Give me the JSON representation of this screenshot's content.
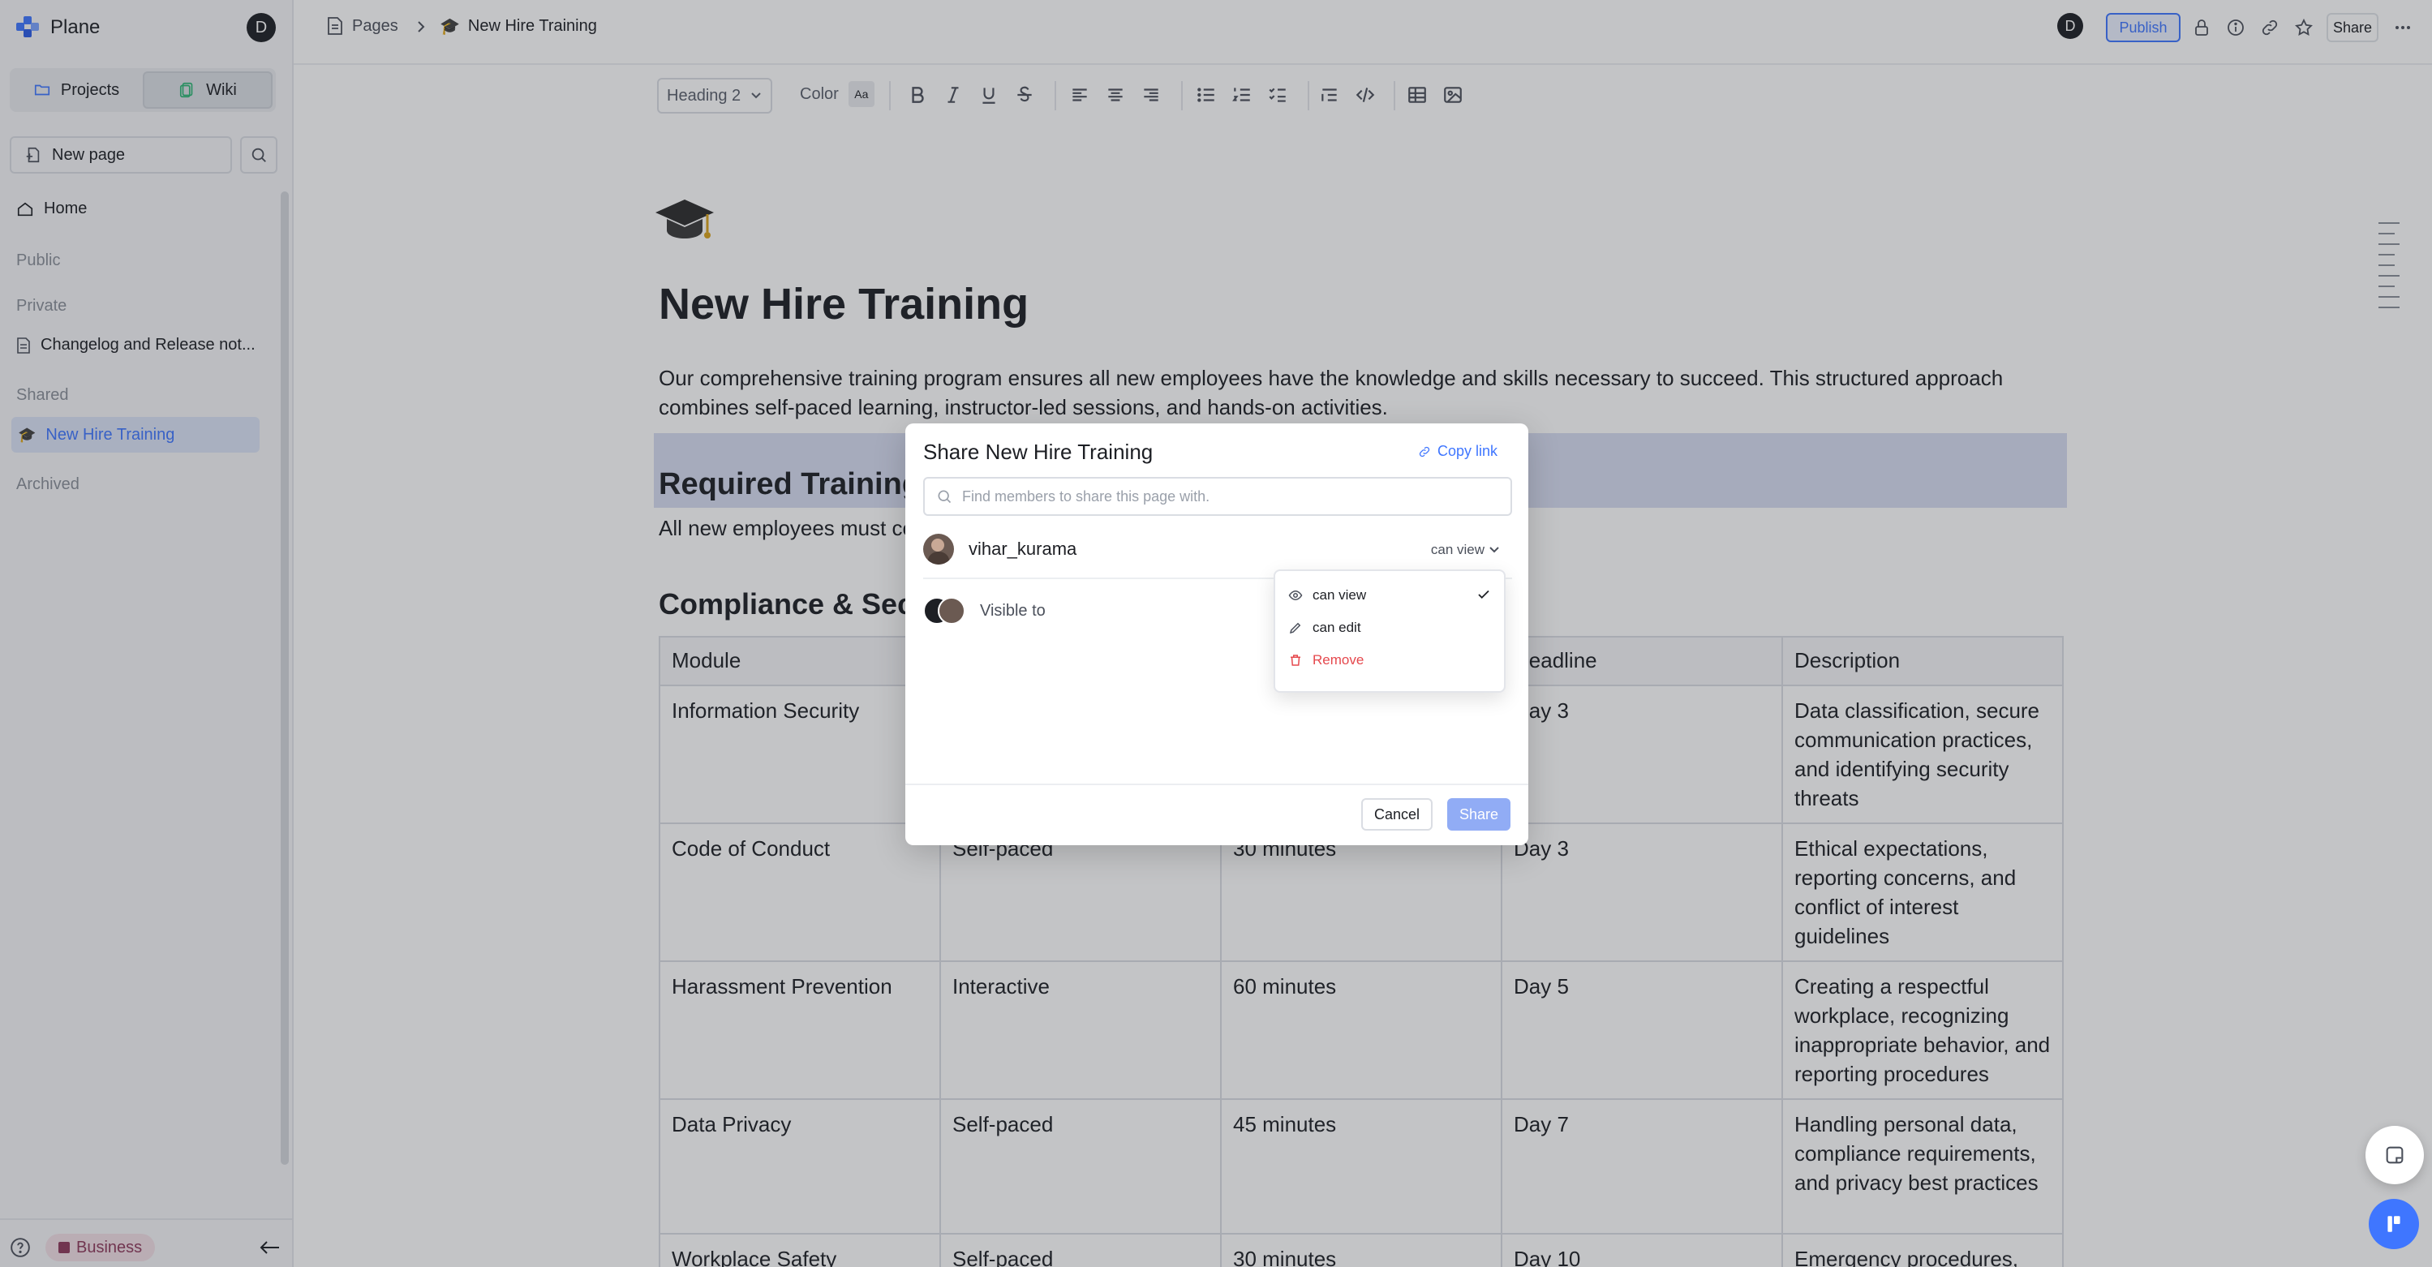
{
  "sidebar": {
    "app_name": "Plane",
    "user_initial": "D",
    "tabs": [
      {
        "label": "Projects",
        "icon": "folder-icon"
      },
      {
        "label": "Wiki",
        "icon": "wiki-icon"
      }
    ],
    "new_page_label": "New page",
    "home_label": "Home",
    "sections": {
      "public": "Public",
      "private": "Private",
      "shared": "Shared",
      "archived": "Archived"
    },
    "private_pages": [
      "Changelog and Release not..."
    ],
    "shared_pages": [
      "New Hire Training"
    ],
    "plan_badge": "Business"
  },
  "header": {
    "breadcrumb_root": "Pages",
    "breadcrumb_page": "New Hire Training",
    "user_initial": "D",
    "publish_label": "Publish",
    "share_label": "Share"
  },
  "toolbar": {
    "heading_select": "Heading 2",
    "color_label": "Color",
    "color_swatch": "Aa"
  },
  "page": {
    "title": "New Hire Training",
    "intro": "Our comprehensive training program ensures all new employees have the knowledge and skills necessary to succeed. This structured approach combines self-paced learning, instructor-led sessions, and hands-on activities.",
    "required_heading": "Required Training",
    "required_text": "All new employees must co",
    "compliance_heading": "Compliance & Secu",
    "table": {
      "headers": [
        "Module",
        "",
        "",
        "Deadline",
        "Description"
      ],
      "rows": [
        [
          "Information Security",
          "",
          "",
          "Day 3",
          "Data classification, secure communication practices, and identifying security threats"
        ],
        [
          "Code of Conduct",
          "Self-paced",
          "30 minutes",
          "Day 3",
          "Ethical expectations, reporting concerns, and conflict of interest guidelines"
        ],
        [
          "Harassment Prevention",
          "Interactive",
          "60 minutes",
          "Day 5",
          "Creating a respectful workplace, recognizing inappropriate behavior, and reporting procedures"
        ],
        [
          "Data Privacy",
          "Self-paced",
          "45 minutes",
          "Day 7",
          "Handling personal data, compliance requirements, and privacy best practices"
        ],
        [
          "Workplace Safety",
          "Self-paced",
          "30 minutes",
          "Day 10",
          "Emergency procedures, ergonomics, and general"
        ]
      ]
    }
  },
  "share_modal": {
    "title": "Share New Hire Training",
    "copy_link": "Copy link",
    "search_placeholder": "Find members to share this page with.",
    "member_name": "vihar_kurama",
    "member_role": "can view",
    "visible_to": "Visible to",
    "cancel_label": "Cancel",
    "share_label": "Share"
  },
  "role_dropdown": {
    "options": [
      "can view",
      "can edit",
      "Remove"
    ],
    "selected": "can view"
  },
  "colors": {
    "accent": "#3f76ff",
    "danger": "#e5484d",
    "business_badge": "#8e3a5c"
  }
}
